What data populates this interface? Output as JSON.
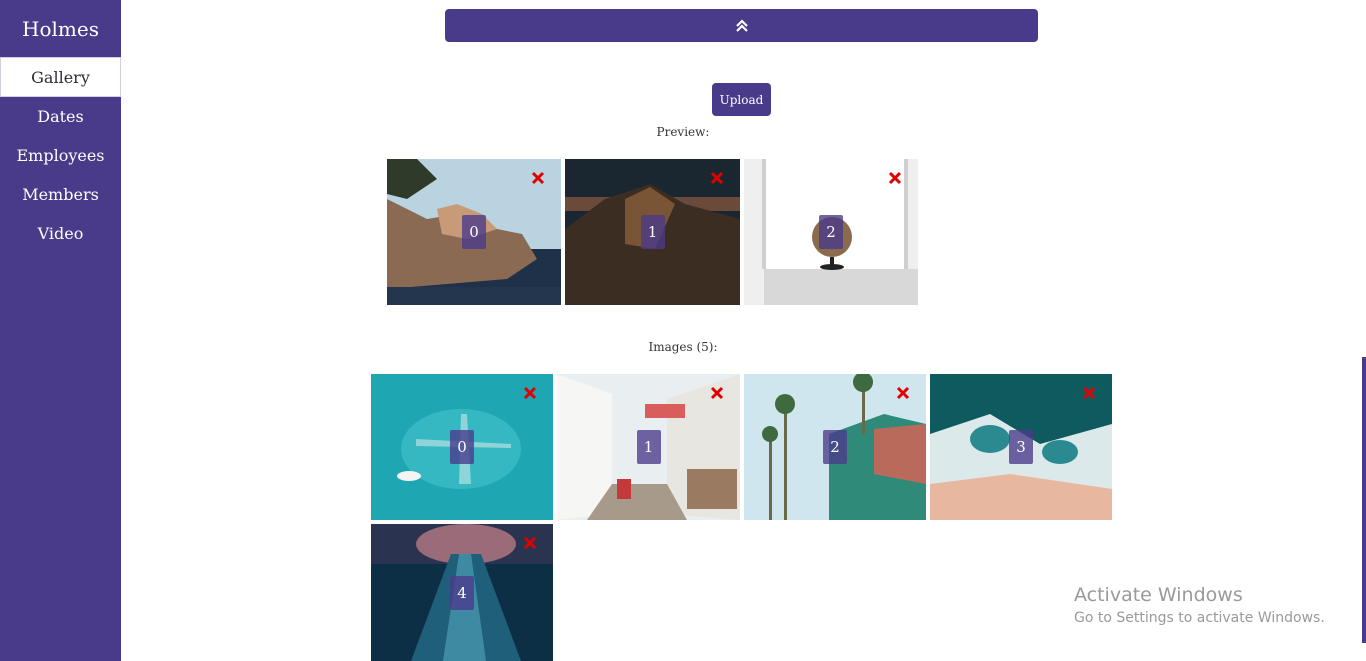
{
  "sidebar": {
    "brand": "Holmes",
    "items": [
      {
        "label": "Gallery"
      },
      {
        "label": "Dates"
      },
      {
        "label": "Employees"
      },
      {
        "label": "Members"
      },
      {
        "label": "Video"
      }
    ]
  },
  "upload": {
    "label": "Upload"
  },
  "preview": {
    "label": "Preview:",
    "tiles": [
      {
        "index": "0",
        "scene": "cliff-town"
      },
      {
        "index": "1",
        "scene": "night-mountain"
      },
      {
        "index": "2",
        "scene": "globe-window"
      }
    ]
  },
  "images": {
    "label": "Images (5):",
    "tiles": [
      {
        "index": "0",
        "scene": "plane-underwater"
      },
      {
        "index": "1",
        "scene": "alley-houses"
      },
      {
        "index": "2",
        "scene": "palm-hotel"
      },
      {
        "index": "3",
        "scene": "ocean-waves"
      },
      {
        "index": "4",
        "scene": "underwater-rays"
      }
    ]
  },
  "watermark": {
    "title": "Activate Windows",
    "subtitle": "Go to Settings to activate Windows."
  },
  "colors": {
    "accent": "#4a3a8a",
    "delete": "#e00000"
  }
}
